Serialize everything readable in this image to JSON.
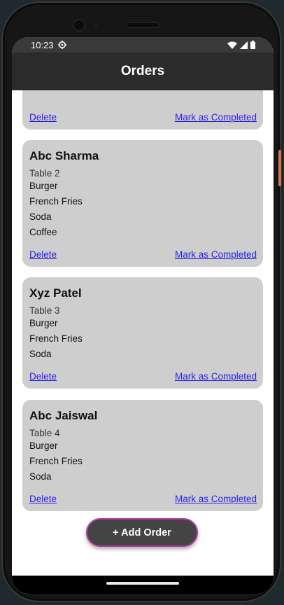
{
  "status_bar": {
    "time": "10:23",
    "settings_icon": "gear-icon",
    "wifi_icon": "wifi-icon",
    "signal_icon": "signal-icon",
    "battery_icon": "battery-icon"
  },
  "app_bar": {
    "title": "Orders"
  },
  "orders": [
    {
      "delete_label": "Delete",
      "complete_label": "Mark as Completed"
    },
    {
      "customer": "Abc Sharma",
      "table": "Table 2",
      "items": [
        "Burger",
        "French Fries",
        "Soda",
        "Coffee"
      ],
      "delete_label": "Delete",
      "complete_label": "Mark as Completed"
    },
    {
      "customer": "Xyz Patel",
      "table": "Table 3",
      "items": [
        "Burger",
        "French Fries",
        "Soda"
      ],
      "delete_label": "Delete",
      "complete_label": "Mark as Completed"
    },
    {
      "customer": "Abc Jaiswal",
      "table": "Table 4",
      "items": [
        "Burger",
        "French Fries",
        "Soda"
      ],
      "delete_label": "Delete",
      "complete_label": "Mark as Completed"
    }
  ],
  "fab": {
    "label": "+ Add Order"
  },
  "colors": {
    "appbar": "#2b2b2b",
    "card": "#cecece",
    "link": "#2a1ee6",
    "fab": "#444444",
    "fab_border": "#b33aa6"
  }
}
